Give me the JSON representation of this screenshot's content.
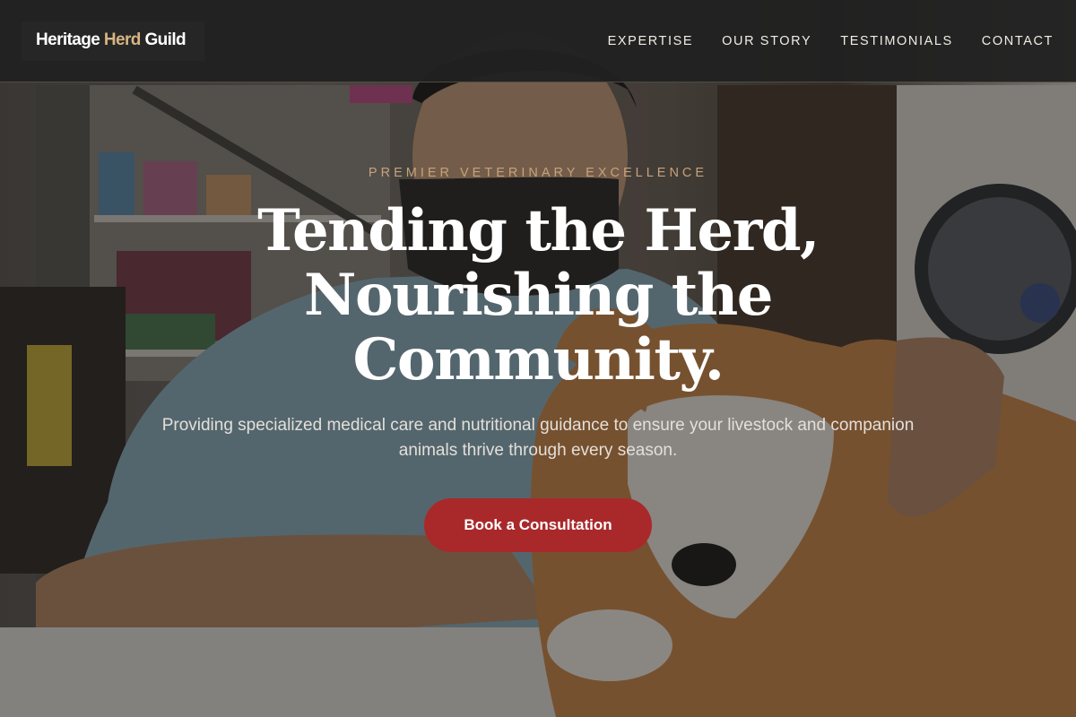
{
  "brand": {
    "name_part1": "Heritage ",
    "name_accent": "Herd",
    "name_part2": " Guild",
    "accent_color": "#d8b483"
  },
  "nav": {
    "items": [
      {
        "label": "EXPERTISE"
      },
      {
        "label": "OUR STORY"
      },
      {
        "label": "TESTIMONIALS"
      },
      {
        "label": "CONTACT"
      }
    ]
  },
  "hero": {
    "eyebrow": "PREMIER VETERINARY EXCELLENCE",
    "headline_lines": [
      "Tending the Herd,",
      "Nourishing the",
      "Community."
    ],
    "subtitle": "Providing specialized medical care and nutritional guidance to ensure your livestock and companion animals thrive through every season.",
    "cta_label": "Book a Consultation",
    "cta_color": "#a9292b",
    "eyebrow_color": "#c6a27a",
    "image_description_icon": "veterinarian-with-dog-photo"
  }
}
